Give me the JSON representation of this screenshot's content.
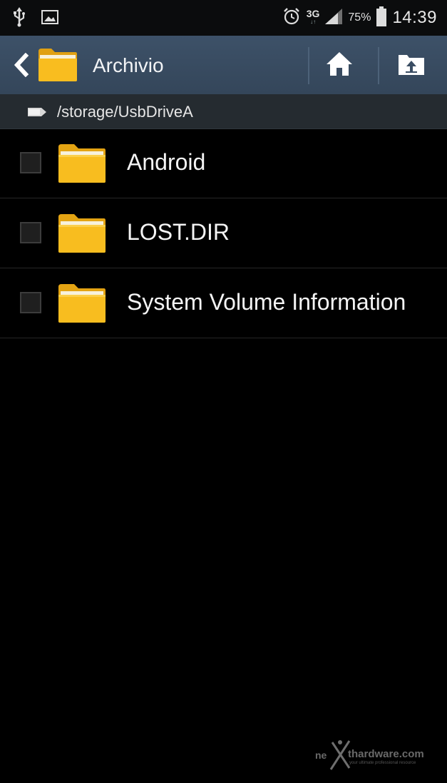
{
  "status_bar": {
    "icons": [
      "usb-icon",
      "image-icon",
      "alarm-icon",
      "signal-icon",
      "battery-icon"
    ],
    "network": "3G",
    "battery_percent": "75%",
    "time": "14:39"
  },
  "action_bar": {
    "title": "Archivio",
    "icons": [
      "back-icon",
      "folder-icon",
      "home-icon",
      "up-folder-icon"
    ]
  },
  "path_bar": {
    "path": "/storage/UsbDriveA"
  },
  "files": [
    {
      "name": "Android",
      "type": "folder",
      "checked": false
    },
    {
      "name": "LOST.DIR",
      "type": "folder",
      "checked": false
    },
    {
      "name": "System Volume Information",
      "type": "folder",
      "checked": false
    }
  ],
  "watermark": {
    "prefix": "ne",
    "brand": "thardware.com",
    "tagline": "your ultimate professional resource"
  },
  "colors": {
    "action_bar": "#3a4d63",
    "path_bar": "#252b30",
    "folder": "#f6b91c",
    "background": "#000000"
  }
}
